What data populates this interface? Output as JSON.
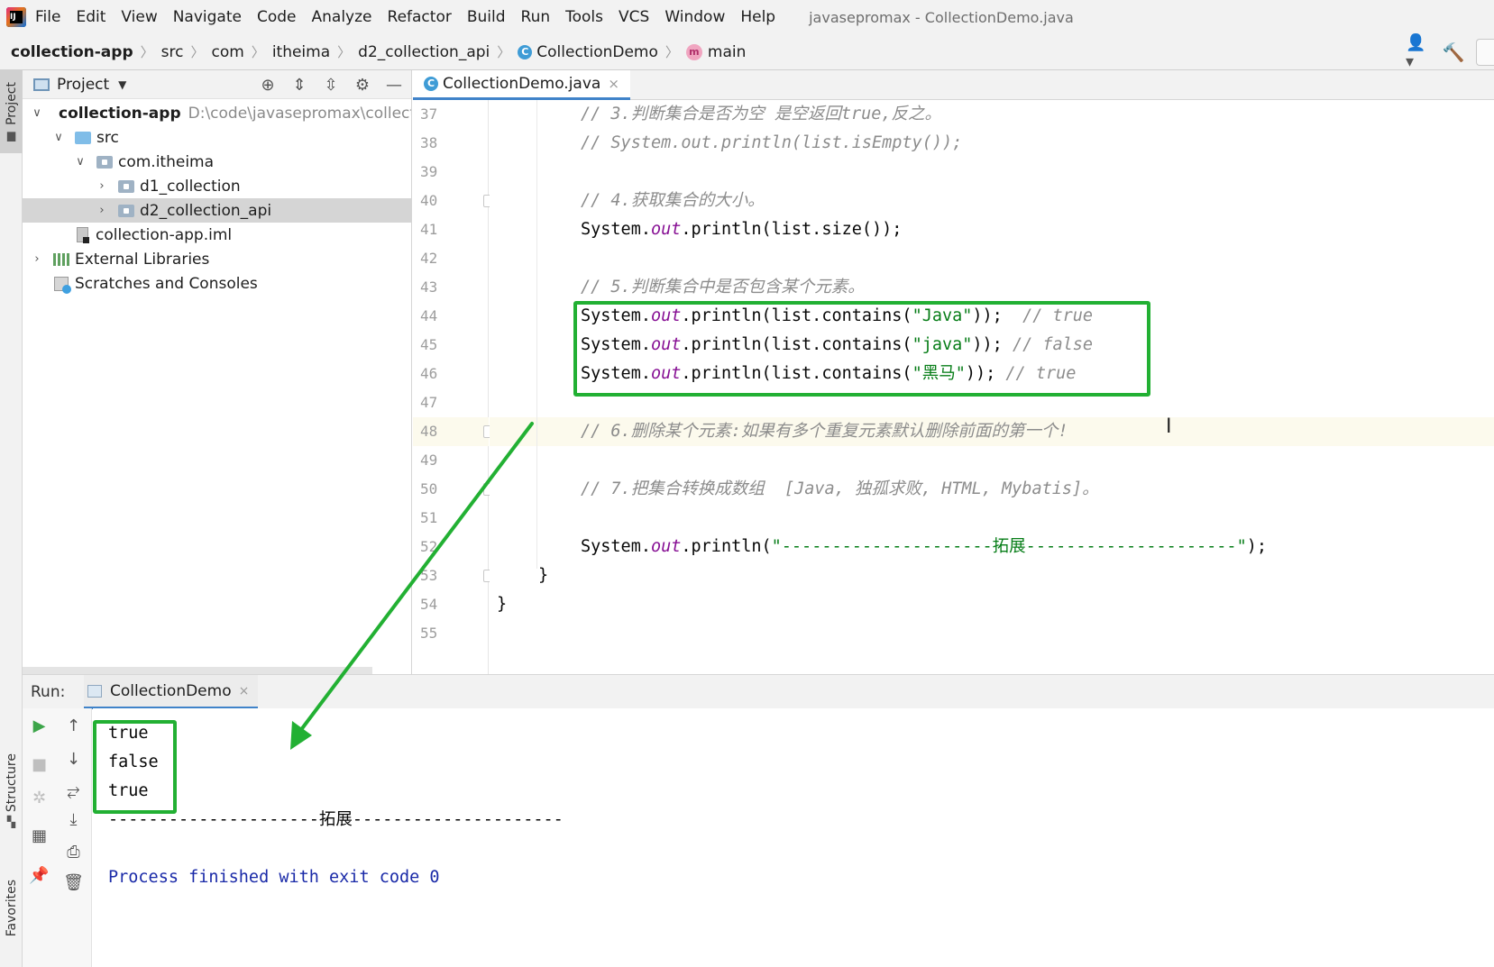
{
  "menubar": {
    "items": [
      "File",
      "Edit",
      "View",
      "Navigate",
      "Code",
      "Analyze",
      "Refactor",
      "Build",
      "Run",
      "Tools",
      "VCS",
      "Window",
      "Help"
    ],
    "title": "javasepromax - CollectionDemo.java"
  },
  "breadcrumb": {
    "project": "collection-app",
    "src": "src",
    "com": "com",
    "pkg": "itheima",
    "module": "d2_collection_api",
    "class": "CollectionDemo",
    "method": "main"
  },
  "left_stripe": {
    "project": "Project",
    "structure": "Structure",
    "favorites": "Favorites"
  },
  "project_panel": {
    "title": "Project",
    "tree": {
      "root_name": "collection-app",
      "root_path": "D:\\code\\javasepromax\\collectio",
      "src": "src",
      "package": "com.itheima",
      "d1": "d1_collection",
      "d2": "d2_collection_api",
      "iml": "collection-app.iml",
      "libs": "External Libraries",
      "scratches": "Scratches and Consoles"
    }
  },
  "editor": {
    "tab_label": "CollectionDemo.java",
    "line_numbers": [
      "37",
      "38",
      "39",
      "40",
      "41",
      "42",
      "43",
      "44",
      "45",
      "46",
      "47",
      "48",
      "49",
      "50",
      "51",
      "52",
      "53",
      "54",
      "55"
    ],
    "code": {
      "l37": "// 3.判断集合是否为空 是空返回true,反之。",
      "l38": "// System.out.println(list.isEmpty());",
      "l40": "// 4.获取集合的大小。",
      "l41_a": "System.",
      "l41_b": "out",
      "l41_c": ".println(list.size());",
      "l43": "// 5.判断集合中是否包含某个元素。",
      "l44_a": "System.",
      "l44_b": "out",
      "l44_c": ".println(list.contains(",
      "l44_d": "\"Java\"",
      "l44_e": "));  ",
      "l44_f": "// true",
      "l45_a": "System.",
      "l45_b": "out",
      "l45_c": ".println(list.contains(",
      "l45_d": "\"java\"",
      "l45_e": ")); ",
      "l45_f": "// false",
      "l46_a": "System.",
      "l46_b": "out",
      "l46_c": ".println(list.contains(",
      "l46_d": "\"黑马\"",
      "l46_e": ")); ",
      "l46_f": "// true",
      "l48": "// 6.删除某个元素:如果有多个重复元素默认删除前面的第一个!",
      "l50": "// 7.把集合转换成数组  [Java, 独孤求败, HTML, Mybatis]。",
      "l52_a": "System.",
      "l52_b": "out",
      "l52_c": ".println(",
      "l52_d": "\"---------------------拓展---------------------\"",
      "l52_e": ");",
      "l53": "}",
      "l54": "}"
    }
  },
  "run_panel": {
    "label": "Run:",
    "tab_label": "CollectionDemo",
    "output": [
      "true",
      "false",
      "true",
      "---------------------拓展---------------------",
      "",
      "Process finished with exit code 0"
    ]
  },
  "colors": {
    "highlight_border": "#22b033",
    "comment": "#8c8c8c",
    "string": "#067d17",
    "static_field": "#871094",
    "tab_underline": "#4083c9"
  }
}
